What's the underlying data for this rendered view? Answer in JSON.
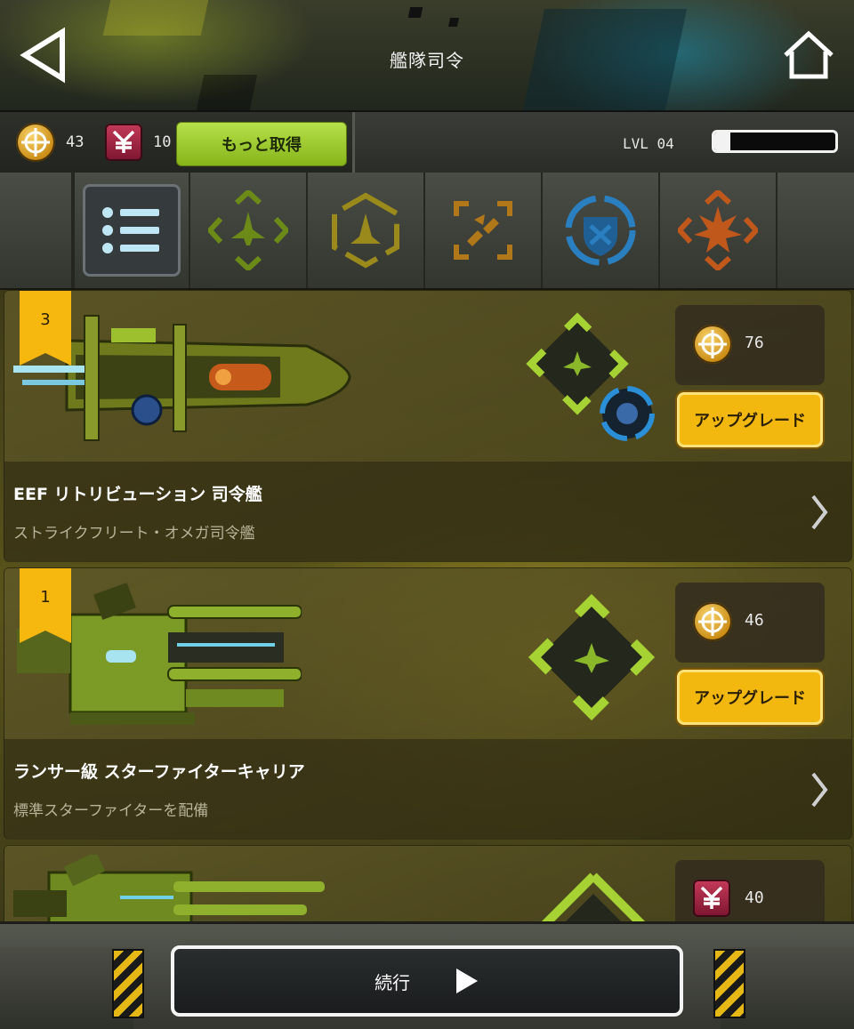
{
  "header": {
    "title": "艦隊司令",
    "back_icon": "back-triangle-icon",
    "home_icon": "home-icon"
  },
  "currency": {
    "gold": {
      "icon": "gold-coin-icon",
      "value": "43"
    },
    "premium": {
      "icon": "premium-token-icon",
      "value": "10"
    },
    "get_more_label": "もっと取得",
    "level_label": "LVL 04",
    "xp_progress": 0.13
  },
  "tabs": [
    {
      "name": "list-icon",
      "active": true,
      "color": "#8fd0e8"
    },
    {
      "name": "fighter-icon",
      "active": false,
      "color": "#6b8a18"
    },
    {
      "name": "frigate-icon",
      "active": false,
      "color": "#9a8a1c"
    },
    {
      "name": "missile-icon",
      "active": false,
      "color": "#b07818"
    },
    {
      "name": "shield-icon",
      "active": false,
      "color": "#2a7fc0"
    },
    {
      "name": "burst-icon",
      "active": false,
      "color": "#c0581c"
    }
  ],
  "ships": [
    {
      "rank": "3",
      "cost": "76",
      "currency": "gold",
      "upgrade_label": "アップグレード",
      "name": "EEF リトリビューション 司令艦",
      "desc": "ストライクフリート・オメガ司令艦"
    },
    {
      "rank": "1",
      "cost": "46",
      "currency": "gold",
      "upgrade_label": "アップグレード",
      "name": "ランサー級 スターファイターキャリア",
      "desc": "標準スターファイターを配備"
    },
    {
      "rank": "",
      "cost": "40",
      "currency": "premium",
      "upgrade_label": "",
      "name": "",
      "desc": ""
    }
  ],
  "footer": {
    "continue_label": "続行",
    "play_icon": "play-icon"
  },
  "colors": {
    "accent_green": "#a6d234",
    "upgrade_yellow": "#f3b810",
    "ribbon": "#f6b70f"
  }
}
